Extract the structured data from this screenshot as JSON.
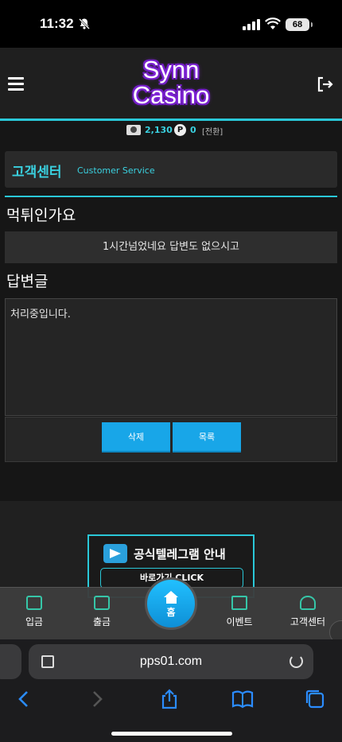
{
  "status_bar": {
    "time": "11:32",
    "battery": "68"
  },
  "header": {
    "logo_line1": "Synn",
    "logo_line2": "Casino"
  },
  "points": {
    "money": "2,130",
    "point_badge": "P",
    "point_value": "0",
    "convert_label": "[전환]"
  },
  "customer_service": {
    "title": "고객센터",
    "subtitle": "Customer Service"
  },
  "inquiry": {
    "question_title": "먹튀인가요",
    "question_body": "1시간넘었네요 답변도 없으시고",
    "answer_heading": "답변글",
    "answer_text": "처리중입니다."
  },
  "buttons": {
    "delete": "삭제",
    "list": "목록"
  },
  "telegram_banner": {
    "text": "공식텔레그램 안내",
    "link": "바로가기 CLICK"
  },
  "bottom_nav": {
    "deposit": "입금",
    "withdraw": "출금",
    "home": "홈",
    "event": "이벤트",
    "support": "고객센터"
  },
  "browser": {
    "url": "pps01.com"
  },
  "colors": {
    "accent": "#2ac8d8",
    "button": "#18a6e8",
    "logo_glow": "#8a2be2"
  }
}
